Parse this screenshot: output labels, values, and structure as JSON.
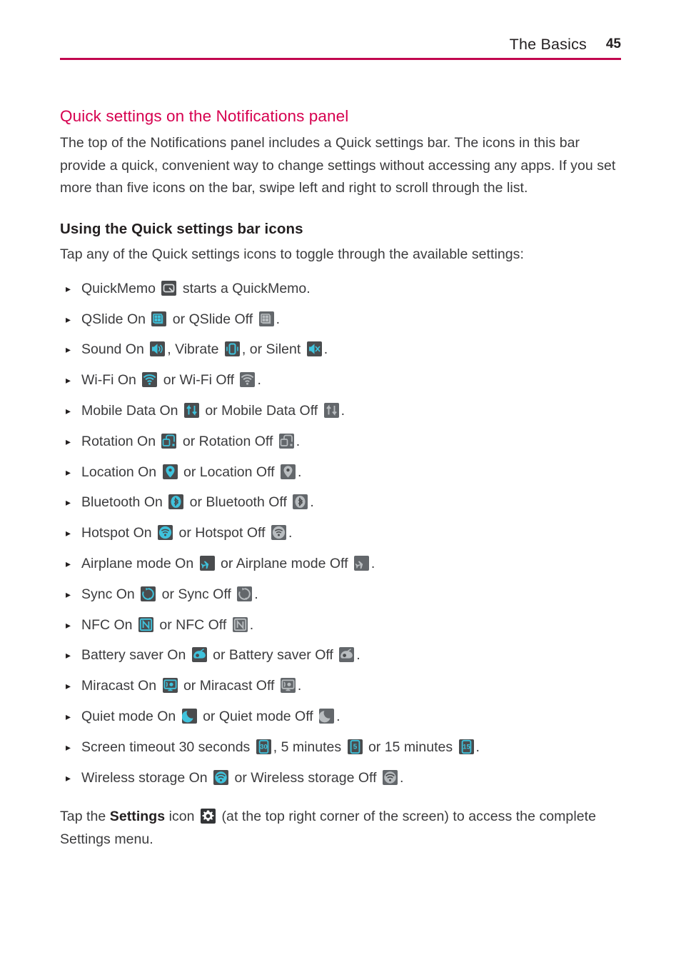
{
  "header": {
    "title": "The Basics",
    "page_number": "45",
    "rule_color": "#c2084f"
  },
  "section": {
    "title": "Quick settings on the Notifications panel",
    "title_color": "#d6004f",
    "intro": "The top of the Notifications panel includes a Quick settings bar. The icons in this bar provide a quick, convenient way to change settings without accessing any apps. If you set more than five icons on the bar, swipe left and right to scroll through the list.",
    "subtitle": "Using the Quick settings bar icons",
    "lead": "Tap any of the Quick settings icons to toggle through the available settings:"
  },
  "bullets": [
    {
      "marker": "▸",
      "segments": [
        {
          "kind": "text",
          "text": "QuickMemo "
        },
        {
          "kind": "icon",
          "icon": "quickmemo-icon",
          "state": "neutral"
        },
        {
          "kind": "text",
          "text": " starts a QuickMemo."
        }
      ]
    },
    {
      "marker": "▸",
      "segments": [
        {
          "kind": "text",
          "text": "QSlide On "
        },
        {
          "kind": "icon",
          "icon": "qslide-icon",
          "state": "on"
        },
        {
          "kind": "text",
          "text": " or QSlide Off "
        },
        {
          "kind": "icon",
          "icon": "qslide-icon",
          "state": "off"
        },
        {
          "kind": "text",
          "text": "."
        }
      ]
    },
    {
      "marker": "▸",
      "segments": [
        {
          "kind": "text",
          "text": "Sound On "
        },
        {
          "kind": "icon",
          "icon": "sound-on-icon",
          "state": "on"
        },
        {
          "kind": "text",
          "text": ", Vibrate "
        },
        {
          "kind": "icon",
          "icon": "vibrate-icon",
          "state": "on"
        },
        {
          "kind": "text",
          "text": ", or Silent "
        },
        {
          "kind": "icon",
          "icon": "silent-icon",
          "state": "on"
        },
        {
          "kind": "text",
          "text": "."
        }
      ]
    },
    {
      "marker": "▸",
      "segments": [
        {
          "kind": "text",
          "text": "Wi-Fi On "
        },
        {
          "kind": "icon",
          "icon": "wifi-icon",
          "state": "on"
        },
        {
          "kind": "text",
          "text": " or Wi-Fi Off "
        },
        {
          "kind": "icon",
          "icon": "wifi-icon",
          "state": "off"
        },
        {
          "kind": "text",
          "text": "."
        }
      ]
    },
    {
      "marker": "▸",
      "segments": [
        {
          "kind": "text",
          "text": "Mobile Data On "
        },
        {
          "kind": "icon",
          "icon": "mobile-data-icon",
          "state": "on"
        },
        {
          "kind": "text",
          "text": " or Mobile Data Off "
        },
        {
          "kind": "icon",
          "icon": "mobile-data-icon",
          "state": "off"
        },
        {
          "kind": "text",
          "text": "."
        }
      ]
    },
    {
      "marker": "▸",
      "segments": [
        {
          "kind": "text",
          "text": "Rotation On "
        },
        {
          "kind": "icon",
          "icon": "rotation-icon",
          "state": "on"
        },
        {
          "kind": "text",
          "text": " or Rotation Off "
        },
        {
          "kind": "icon",
          "icon": "rotation-icon",
          "state": "off"
        },
        {
          "kind": "text",
          "text": "."
        }
      ]
    },
    {
      "marker": "▸",
      "segments": [
        {
          "kind": "text",
          "text": "Location On "
        },
        {
          "kind": "icon",
          "icon": "location-icon",
          "state": "on"
        },
        {
          "kind": "text",
          "text": " or Location Off "
        },
        {
          "kind": "icon",
          "icon": "location-icon",
          "state": "off"
        },
        {
          "kind": "text",
          "text": "."
        }
      ]
    },
    {
      "marker": "▸",
      "segments": [
        {
          "kind": "text",
          "text": "Bluetooth On "
        },
        {
          "kind": "icon",
          "icon": "bluetooth-icon",
          "state": "on"
        },
        {
          "kind": "text",
          "text": " or Bluetooth Off "
        },
        {
          "kind": "icon",
          "icon": "bluetooth-icon",
          "state": "off"
        },
        {
          "kind": "text",
          "text": "."
        }
      ]
    },
    {
      "marker": "▸",
      "segments": [
        {
          "kind": "text",
          "text": "Hotspot On "
        },
        {
          "kind": "icon",
          "icon": "hotspot-icon",
          "state": "on"
        },
        {
          "kind": "text",
          "text": " or Hotspot Off "
        },
        {
          "kind": "icon",
          "icon": "hotspot-icon",
          "state": "off"
        },
        {
          "kind": "text",
          "text": "."
        }
      ]
    },
    {
      "marker": "▸",
      "segments": [
        {
          "kind": "text",
          "text": "Airplane mode On "
        },
        {
          "kind": "icon",
          "icon": "airplane-icon",
          "state": "on"
        },
        {
          "kind": "text",
          "text": " or Airplane mode Off "
        },
        {
          "kind": "icon",
          "icon": "airplane-icon",
          "state": "off"
        },
        {
          "kind": "text",
          "text": "."
        }
      ]
    },
    {
      "marker": "▸",
      "segments": [
        {
          "kind": "text",
          "text": "Sync On "
        },
        {
          "kind": "icon",
          "icon": "sync-icon",
          "state": "on"
        },
        {
          "kind": "text",
          "text": " or Sync Off "
        },
        {
          "kind": "icon",
          "icon": "sync-icon",
          "state": "off"
        },
        {
          "kind": "text",
          "text": "."
        }
      ]
    },
    {
      "marker": "▸",
      "segments": [
        {
          "kind": "text",
          "text": "NFC On "
        },
        {
          "kind": "icon",
          "icon": "nfc-icon",
          "state": "on"
        },
        {
          "kind": "text",
          "text": " or NFC Off "
        },
        {
          "kind": "icon",
          "icon": "nfc-icon",
          "state": "off"
        },
        {
          "kind": "text",
          "text": "."
        }
      ]
    },
    {
      "marker": "▸",
      "segments": [
        {
          "kind": "text",
          "text": "Battery saver On "
        },
        {
          "kind": "icon",
          "icon": "battery-saver-icon",
          "state": "on"
        },
        {
          "kind": "text",
          "text": " or Battery saver Off "
        },
        {
          "kind": "icon",
          "icon": "battery-saver-icon",
          "state": "off"
        },
        {
          "kind": "text",
          "text": "."
        }
      ]
    },
    {
      "marker": "▸",
      "segments": [
        {
          "kind": "text",
          "text": "Miracast On "
        },
        {
          "kind": "icon",
          "icon": "miracast-icon",
          "state": "on"
        },
        {
          "kind": "text",
          "text": " or Miracast Off "
        },
        {
          "kind": "icon",
          "icon": "miracast-icon",
          "state": "off"
        },
        {
          "kind": "text",
          "text": "."
        }
      ]
    },
    {
      "marker": "▸",
      "segments": [
        {
          "kind": "text",
          "text": "Quiet mode On "
        },
        {
          "kind": "icon",
          "icon": "quiet-mode-icon",
          "state": "on"
        },
        {
          "kind": "text",
          "text": " or Quiet mode Off "
        },
        {
          "kind": "icon",
          "icon": "quiet-mode-icon",
          "state": "off"
        },
        {
          "kind": "text",
          "text": "."
        }
      ]
    },
    {
      "marker": "▸",
      "segments": [
        {
          "kind": "text",
          "text": "Screen timeout 30 seconds "
        },
        {
          "kind": "icon",
          "icon": "timeout-30s-icon",
          "state": "on"
        },
        {
          "kind": "text",
          "text": ", 5 minutes "
        },
        {
          "kind": "icon",
          "icon": "timeout-5m-icon",
          "state": "on"
        },
        {
          "kind": "text",
          "text": " or 15 minutes "
        },
        {
          "kind": "icon",
          "icon": "timeout-15m-icon",
          "state": "on"
        },
        {
          "kind": "text",
          "text": "."
        }
      ]
    },
    {
      "marker": "▸",
      "segments": [
        {
          "kind": "text",
          "text": "Wireless storage On "
        },
        {
          "kind": "icon",
          "icon": "wireless-storage-icon",
          "state": "on"
        },
        {
          "kind": "text",
          "text": " or Wireless storage Off "
        },
        {
          "kind": "icon",
          "icon": "wireless-storage-icon",
          "state": "off"
        },
        {
          "kind": "text",
          "text": "."
        }
      ]
    }
  ],
  "closing": {
    "before": "Tap the ",
    "bold": "Settings",
    "middle": " icon ",
    "icon": "gear-icon",
    "after": " (at the top right corner of the screen) to access the complete Settings menu."
  },
  "colors": {
    "accent_heading": "#d6004f",
    "accent_rule": "#c2084f",
    "body_text": "#3b3b3d",
    "icon_tile": "#4a4c4e",
    "icon_on_glyph": "#3fc3dd",
    "icon_off_glyph": "#b9bdc0"
  }
}
